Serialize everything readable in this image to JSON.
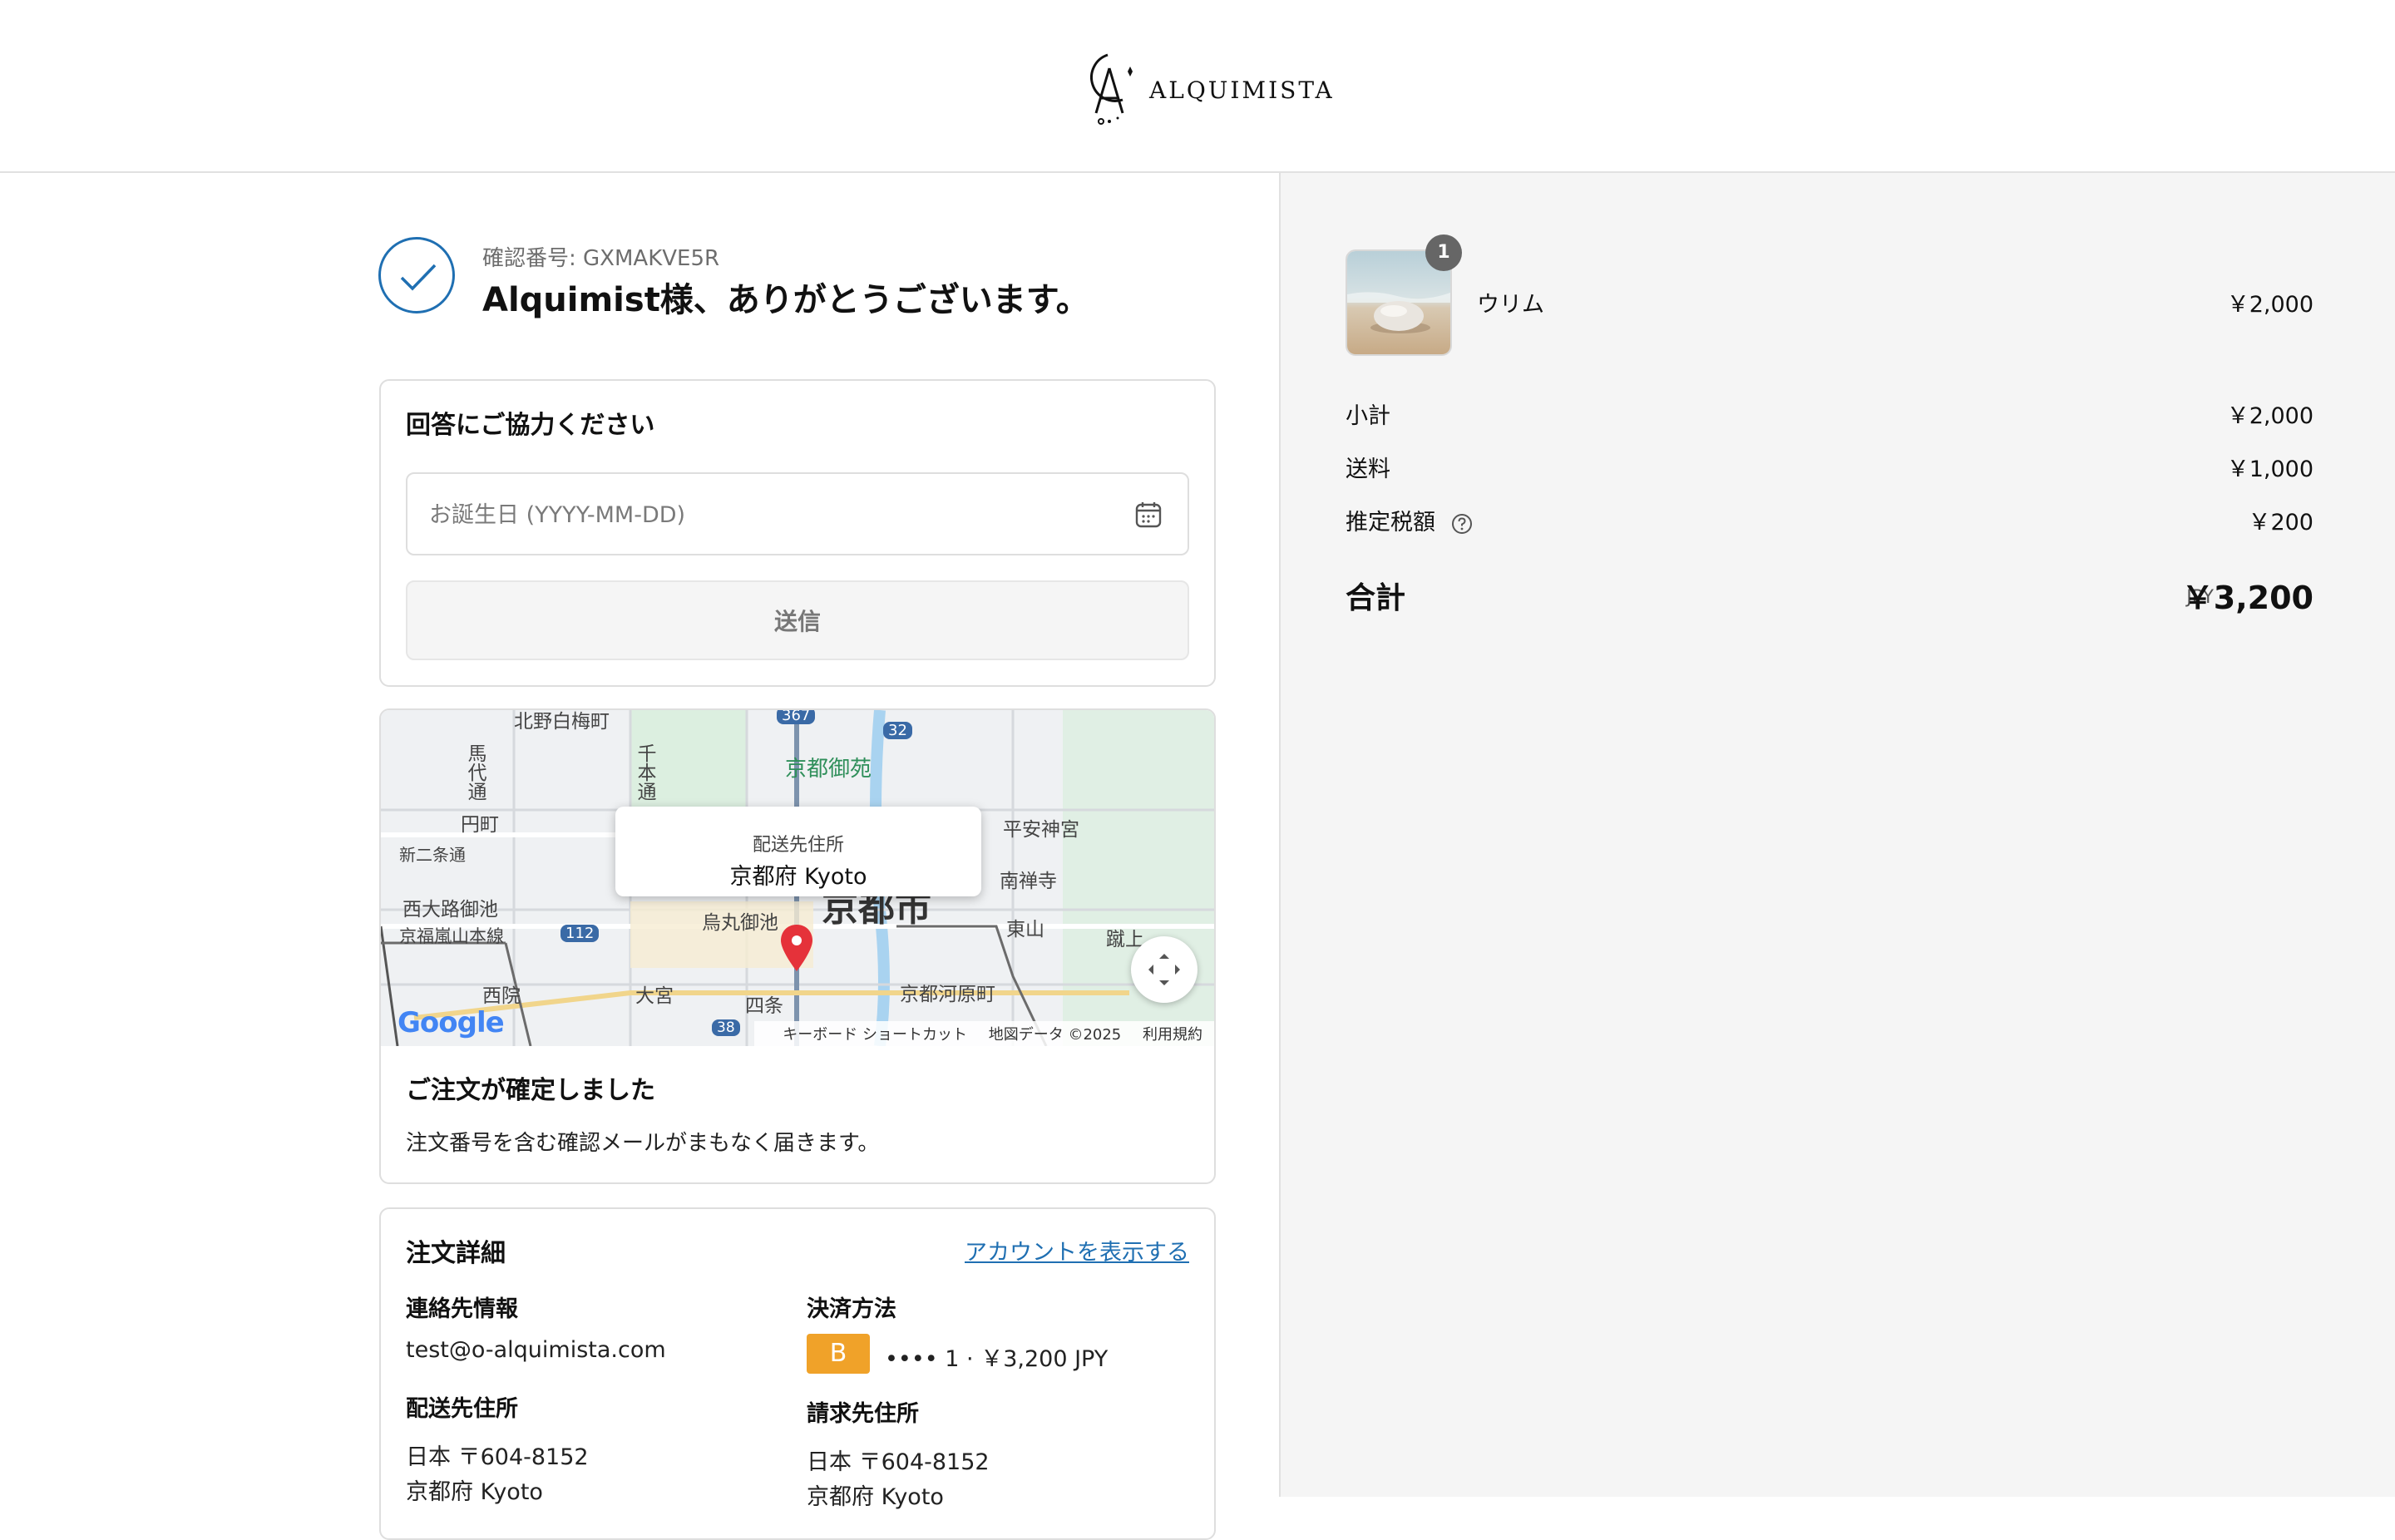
{
  "brand": {
    "name": "ALQUIMISTA"
  },
  "confirmation": {
    "number_label": "確認番号: GXMAKVE5R",
    "thanks": "Alquimist様、ありがとうございます。"
  },
  "survey": {
    "title": "回答にご協力ください",
    "birthday_placeholder": "お誕生日 (YYYY-MM-DD)",
    "submit_label": "送信"
  },
  "map": {
    "labels": {
      "kitano": "北野白梅町",
      "gosho": "京都御苑",
      "heian": "平安神宮",
      "enmachi": "円町",
      "shinnijo": "新二条通",
      "nanzenji": "南禅寺",
      "nishioji": "西大路御池",
      "karasuma": "烏丸御池",
      "higashiyama": "東山",
      "keage": "蹴上",
      "sagano": "京福嵐山本線",
      "saiin": "西院",
      "omiya": "大宮",
      "shijo": "四条",
      "kawaramachi": "京都河原町",
      "kyoto_city": "京都市",
      "senbon": "千本通",
      "baba": "馬代通",
      "road32": "32",
      "road367": "367",
      "road112": "112",
      "road38": "38"
    },
    "tooltip_title": "配送先住所",
    "tooltip_value": "京都府 Kyoto",
    "google": "Google",
    "footer": {
      "shortcuts": "キーボード ショートカット",
      "data": "地図データ ©2025",
      "terms": "利用規約"
    }
  },
  "order_confirmed": {
    "title": "ご注文が確定しました",
    "desc": "注文番号を含む確認メールがまもなく届きます。"
  },
  "order_details": {
    "title": "注文詳細",
    "account_link": "アカウントを表示する",
    "contact_heading": "連絡先情報",
    "contact_email": "test@o-alquimista.com",
    "payment_heading": "決済方法",
    "payment_badge": "B",
    "payment_text": "•••• 1 · ￥3,200 JPY",
    "shipping_heading": "配送先住所",
    "shipping_line1": "日本 〒604-8152",
    "shipping_line2": "京都府 Kyoto",
    "billing_heading": "請求先住所",
    "billing_line1": "日本 〒604-8152",
    "billing_line2": "京都府 Kyoto"
  },
  "summary": {
    "item": {
      "name": "ウリム",
      "price": "￥2,000",
      "quantity": "1"
    },
    "subtotal_label": "小計",
    "subtotal": "￥2,000",
    "shipping_label": "送料",
    "shipping": "￥1,000",
    "tax_label": "推定税額",
    "tax": "￥200",
    "total_label": "合計",
    "currency": "JPY",
    "total": "￥3,200"
  },
  "colors": {
    "accent": "#1f6fb2",
    "pay_badge": "#f0a229",
    "pin": "#e5323a"
  },
  "icons": [
    "check-icon",
    "calendar-icon",
    "map-pin-icon",
    "expand-icon",
    "help-icon"
  ]
}
